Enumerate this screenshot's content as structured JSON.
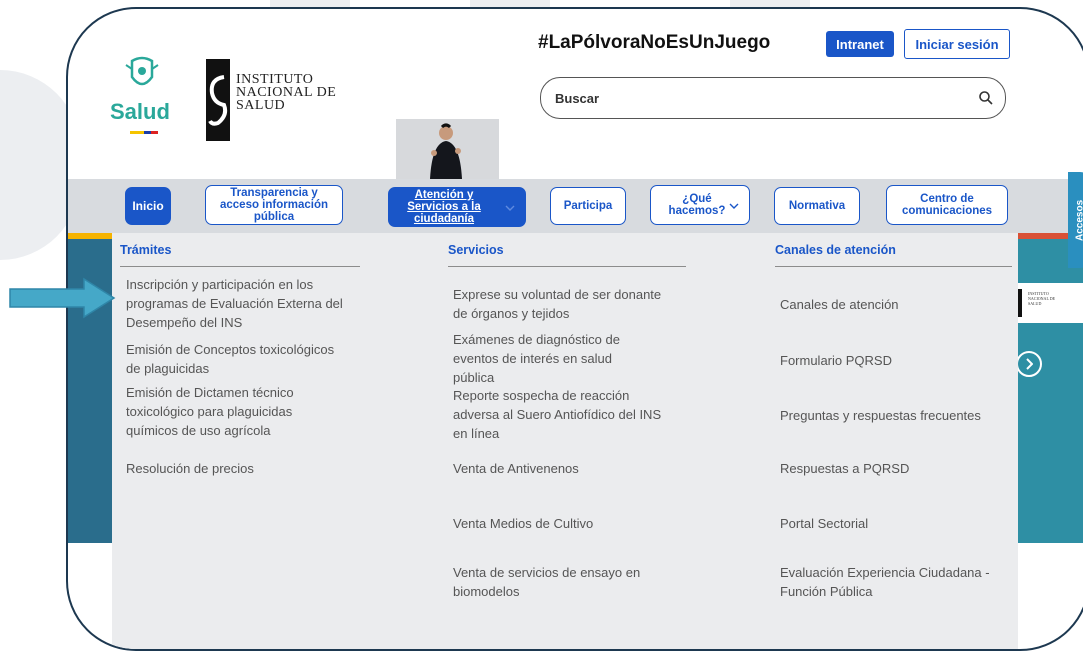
{
  "header": {
    "hashtag": "#LaPólvoraNoEsUnJuego",
    "intranet_label": "Intranet",
    "login_label": "Iniciar sesión",
    "salud_logo_text": "Salud",
    "ins_logo_lines": [
      "Instituto",
      "Nacional de",
      "Salud"
    ],
    "search_placeholder": "Buscar"
  },
  "nav": {
    "items": [
      {
        "label": "Inicio",
        "active": true
      },
      {
        "label": "Transparencia y acceso información pública"
      },
      {
        "label": "Atención y Servicios a la ciudadanía",
        "active": true,
        "has_chevron": true
      },
      {
        "label": "Participa"
      },
      {
        "label": "¿Qué hacemos?",
        "has_chevron": true
      },
      {
        "label": "Normativa"
      },
      {
        "label": "Centro de comunicaciones"
      }
    ]
  },
  "dropdown": {
    "columns": [
      {
        "title": "Trámites",
        "items": [
          "Inscripción y participación en los programas de Evaluación Externa del Desempeño del INS",
          "Emisión de Conceptos toxicológicos de plaguicidas",
          "Emisión de Dictamen técnico toxicológico para plaguicidas químicos de uso agrícola",
          "Resolución de precios"
        ]
      },
      {
        "title": "Servicios",
        "items": [
          "Exprese su voluntad de ser donante de órganos y tejidos",
          "Exámenes de diagnóstico de eventos de interés en salud pública",
          "Reporte sospecha de reacción adversa al Suero Antiofídico del INS en línea",
          "Venta de Antivenenos",
          "Venta Medios de Cultivo",
          "Venta de servicios de ensayo en biomodelos"
        ]
      },
      {
        "title": "Canales de atención",
        "items": [
          "Canales de atención",
          "Formulario PQRSD",
          "Preguntas y respuestas frecuentes",
          "Respuestas a PQRSD",
          "Portal Sectorial",
          "Evaluación Experiencia Ciudadana - Función Pública"
        ]
      }
    ]
  },
  "side": {
    "accesos_label": "Accesos",
    "banner_ins_text": [
      "Instituto",
      "Nacional de",
      "Salud"
    ]
  },
  "colors": {
    "brand_blue": "#1a56c8",
    "frame_border": "#1d3850",
    "arrow": "#45a8c8",
    "salud_green": "#2aa89a"
  }
}
